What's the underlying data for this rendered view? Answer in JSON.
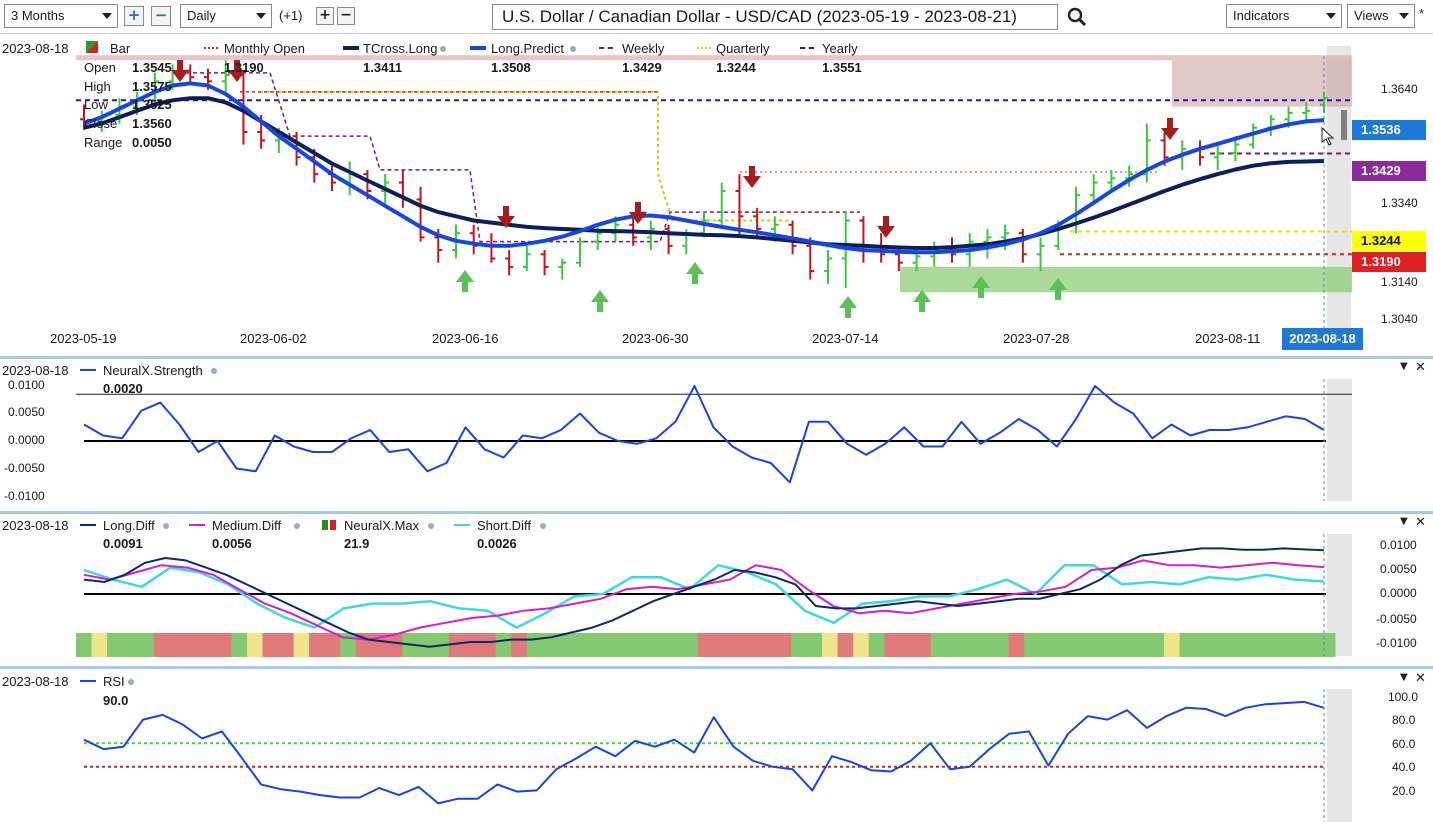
{
  "toolbar": {
    "range": "3 Months",
    "period": "Daily",
    "offset": "(+1)",
    "title": "U.S. Dollar / Canadian Dollar - USD/CAD (2023-05-19 - 2023-08-21)",
    "indicators": "Indicators",
    "views": "Views",
    "asterisk": "*"
  },
  "main": {
    "date": "2023-08-18",
    "legend": [
      {
        "label": "Bar",
        "value": "",
        "color": "#d62020"
      },
      {
        "label": "Monthly Open",
        "value": "1.3190",
        "color": "#d62020"
      },
      {
        "label": "TCross.Long",
        "value": "1.3411",
        "color": "#0b1f5a"
      },
      {
        "label": "Long.Predict",
        "value": "1.3508",
        "color": "#1646e0"
      },
      {
        "label": "Weekly",
        "value": "1.3429",
        "color": "#7a1f6a"
      },
      {
        "label": "Quarterly",
        "value": "1.3244",
        "color": "#e0e000"
      },
      {
        "label": "Yearly",
        "value": "1.3551",
        "color": "#1a1ab8"
      }
    ],
    "ohlc": {
      "open_label": "Open",
      "open": "1.3545",
      "high_label": "High",
      "high": "1.3575",
      "low_label": "Low",
      "low": "1.3525",
      "close_label": "Close",
      "close": "1.3560",
      "range_label": "Range",
      "range": "0.0050"
    },
    "y_ticks": [
      "1.3640",
      "1.3540",
      "1.3440",
      "1.3340",
      "1.3240",
      "1.3140",
      "1.3040"
    ],
    "price_tags": [
      {
        "value": "1.3536",
        "bg": "#1e78d6",
        "fg": "#ffffff"
      },
      {
        "value": "1.3429",
        "bg": "#8b2a9a",
        "fg": "#ffffff"
      },
      {
        "value": "1.3244",
        "bg": "#ffff00",
        "fg": "#111111"
      },
      {
        "value": "1.3190",
        "bg": "#e02020",
        "fg": "#ffffff"
      }
    ],
    "x_dates": [
      "2023-05-19",
      "2023-06-02",
      "2023-06-16",
      "2023-06-30",
      "2023-07-14",
      "2023-07-28",
      "2023-08-11"
    ],
    "x_date_current": "2023-08-18"
  },
  "neural": {
    "date": "2023-08-18",
    "label": "NeuralX.Strength",
    "value": "0.0020",
    "y_ticks": [
      "0.0100",
      "0.0050",
      "0.0000",
      "-0.0050",
      "-0.0100"
    ]
  },
  "diff": {
    "date": "2023-08-18",
    "legend": [
      {
        "label": "Long.Diff",
        "value": "0.0091",
        "color": "#0b2a6a"
      },
      {
        "label": "Medium.Diff",
        "value": "0.0056",
        "color": "#d020d0"
      },
      {
        "label": "NeuralX.Max",
        "value": "21.9",
        "color": "#2a8a2a"
      },
      {
        "label": "Short.Diff",
        "value": "0.0026",
        "color": "#40d8e0"
      }
    ],
    "y_ticks": [
      "0.0100",
      "0.0050",
      "0.0000",
      "-0.0050",
      "-0.0100"
    ]
  },
  "rsi": {
    "date": "2023-08-18",
    "label": "RSI",
    "value": "90.0",
    "y_ticks": [
      "100.0",
      "80.0",
      "60.0",
      "40.0",
      "20.0"
    ]
  },
  "chart_data": [
    {
      "type": "bar",
      "title": "U.S. Dollar / Canadian Dollar - USD/CAD (2023-05-19 - 2023-08-21)",
      "x_dates": [
        "2023-05-19",
        "2023-06-02",
        "2023-06-16",
        "2023-06-30",
        "2023-07-14",
        "2023-07-28",
        "2023-08-11",
        "2023-08-18"
      ],
      "ylim": [
        1.302,
        1.366
      ],
      "levels": {
        "monthly_open": 1.319,
        "weekly": 1.3429,
        "quarterly": 1.3244,
        "yearly": 1.3551
      },
      "last_bar": {
        "open": 1.3545,
        "high": 1.3575,
        "low": 1.3525,
        "close": 1.356
      },
      "ohlc": [
        [
          1.351,
          1.3545,
          1.3485,
          1.3505
        ],
        [
          1.3505,
          1.353,
          1.348,
          1.352
        ],
        [
          1.352,
          1.356,
          1.35,
          1.354
        ],
        [
          1.354,
          1.3575,
          1.352,
          1.3555
        ],
        [
          1.3555,
          1.362,
          1.354,
          1.36
        ],
        [
          1.36,
          1.364,
          1.358,
          1.3625
        ],
        [
          1.3625,
          1.364,
          1.359,
          1.361
        ],
        [
          1.361,
          1.363,
          1.358,
          1.36
        ],
        [
          1.36,
          1.365,
          1.357,
          1.3615
        ],
        [
          1.3615,
          1.3625,
          1.345,
          1.348
        ],
        [
          1.348,
          1.352,
          1.344,
          1.346
        ],
        [
          1.346,
          1.349,
          1.343,
          1.347
        ],
        [
          1.347,
          1.348,
          1.34,
          1.342
        ],
        [
          1.342,
          1.344,
          1.336,
          1.338
        ],
        [
          1.338,
          1.34,
          1.334,
          1.336
        ],
        [
          1.336,
          1.341,
          1.333,
          1.338
        ],
        [
          1.338,
          1.339,
          1.332,
          1.334
        ],
        [
          1.334,
          1.338,
          1.331,
          1.336
        ],
        [
          1.336,
          1.339,
          1.33,
          1.332
        ],
        [
          1.332,
          1.335,
          1.322,
          1.323
        ],
        [
          1.323,
          1.325,
          1.317,
          1.32
        ],
        [
          1.32,
          1.326,
          1.318,
          1.324
        ],
        [
          1.324,
          1.326,
          1.319,
          1.321
        ],
        [
          1.321,
          1.324,
          1.317,
          1.318
        ],
        [
          1.318,
          1.32,
          1.314,
          1.316
        ],
        [
          1.316,
          1.321,
          1.315,
          1.319
        ],
        [
          1.319,
          1.32,
          1.314,
          1.316
        ],
        [
          1.316,
          1.318,
          1.313,
          1.317
        ],
        [
          1.317,
          1.323,
          1.316,
          1.322
        ],
        [
          1.322,
          1.326,
          1.32,
          1.324
        ],
        [
          1.324,
          1.328,
          1.322,
          1.326
        ],
        [
          1.326,
          1.329,
          1.321,
          1.323
        ],
        [
          1.323,
          1.327,
          1.32,
          1.325
        ],
        [
          1.325,
          1.326,
          1.319,
          1.321
        ],
        [
          1.321,
          1.325,
          1.319,
          1.324
        ],
        [
          1.324,
          1.329,
          1.323,
          1.327
        ],
        [
          1.327,
          1.336,
          1.326,
          1.334
        ],
        [
          1.334,
          1.338,
          1.323,
          1.328
        ],
        [
          1.328,
          1.33,
          1.323,
          1.325
        ],
        [
          1.325,
          1.328,
          1.322,
          1.326
        ],
        [
          1.326,
          1.327,
          1.319,
          1.321
        ],
        [
          1.321,
          1.323,
          1.313,
          1.315
        ],
        [
          1.315,
          1.32,
          1.312,
          1.318
        ],
        [
          1.318,
          1.329,
          1.311,
          1.327
        ],
        [
          1.327,
          1.328,
          1.317,
          1.32
        ],
        [
          1.32,
          1.324,
          1.317,
          1.319
        ],
        [
          1.319,
          1.321,
          1.315,
          1.317
        ],
        [
          1.317,
          1.32,
          1.315,
          1.3185
        ],
        [
          1.3185,
          1.322,
          1.316,
          1.32
        ],
        [
          1.32,
          1.323,
          1.317,
          1.319
        ],
        [
          1.319,
          1.324,
          1.316,
          1.322
        ],
        [
          1.322,
          1.325,
          1.318,
          1.323
        ],
        [
          1.323,
          1.326,
          1.32,
          1.324
        ],
        [
          1.324,
          1.325,
          1.317,
          1.319
        ],
        [
          1.319,
          1.323,
          1.315,
          1.321
        ],
        [
          1.321,
          1.327,
          1.32,
          1.326
        ],
        [
          1.326,
          1.335,
          1.324,
          1.333
        ],
        [
          1.333,
          1.338,
          1.331,
          1.336
        ],
        [
          1.336,
          1.339,
          1.334,
          1.337
        ],
        [
          1.337,
          1.34,
          1.335,
          1.338
        ],
        [
          1.338,
          1.35,
          1.336,
          1.346
        ],
        [
          1.346,
          1.348,
          1.34,
          1.342
        ],
        [
          1.342,
          1.346,
          1.339,
          1.344
        ],
        [
          1.344,
          1.346,
          1.34,
          1.342
        ],
        [
          1.342,
          1.345,
          1.339,
          1.343
        ],
        [
          1.343,
          1.347,
          1.341,
          1.345
        ],
        [
          1.345,
          1.35,
          1.344,
          1.349
        ],
        [
          1.349,
          1.352,
          1.347,
          1.351
        ],
        [
          1.351,
          1.354,
          1.349,
          1.3525
        ],
        [
          1.3525,
          1.355,
          1.35,
          1.353
        ],
        [
          1.3545,
          1.3575,
          1.3525,
          1.356
        ]
      ],
      "series": [
        {
          "name": "TCross.Long",
          "values": [
            1.349,
            1.35,
            1.3515,
            1.353,
            1.3545,
            1.3555,
            1.356,
            1.356,
            1.355,
            1.353,
            1.3505,
            1.348,
            1.3455,
            1.343,
            1.3405,
            1.3385,
            1.3365,
            1.3345,
            1.3325,
            1.3305,
            1.329,
            1.328,
            1.327,
            1.3265,
            1.326,
            1.3255,
            1.3252,
            1.325,
            1.3248,
            1.3246,
            1.3245,
            1.3244,
            1.3242,
            1.324,
            1.3238,
            1.3236,
            1.3235,
            1.3233,
            1.323,
            1.3226,
            1.3222,
            1.3218,
            1.3214,
            1.3212,
            1.321,
            1.3208,
            1.3206,
            1.3205,
            1.3205,
            1.3207,
            1.321,
            1.3214,
            1.322,
            1.3228,
            1.3238,
            1.325,
            1.3263,
            1.3277,
            1.3292,
            1.3308,
            1.3324,
            1.334,
            1.3355,
            1.3368,
            1.338,
            1.3391,
            1.34,
            1.3406,
            1.3409,
            1.341,
            1.3411
          ]
        },
        {
          "name": "Long.Predict",
          "values": [
            1.35,
            1.3515,
            1.3535,
            1.3555,
            1.3575,
            1.359,
            1.3595,
            1.359,
            1.357,
            1.354,
            1.3505,
            1.347,
            1.344,
            1.341,
            1.338,
            1.3355,
            1.333,
            1.3305,
            1.328,
            1.3255,
            1.3235,
            1.3222,
            1.3215,
            1.321,
            1.321,
            1.3215,
            1.3222,
            1.3232,
            1.3245,
            1.326,
            1.3272,
            1.328,
            1.3282,
            1.3278,
            1.327,
            1.3262,
            1.3255,
            1.3248,
            1.3242,
            1.3235,
            1.3228,
            1.322,
            1.3212,
            1.3205,
            1.32,
            1.3198,
            1.3196,
            1.3195,
            1.3195,
            1.3197,
            1.32,
            1.3206,
            1.3214,
            1.3225,
            1.324,
            1.326,
            1.3285,
            1.3312,
            1.334,
            1.3366,
            1.339,
            1.341,
            1.3426,
            1.344,
            1.3452,
            1.3464,
            1.3476,
            1.3488,
            1.3498,
            1.3505,
            1.3508
          ]
        }
      ]
    },
    {
      "type": "line",
      "title": "NeuralX.Strength",
      "ylim": [
        -0.01,
        0.01
      ],
      "series": [
        {
          "name": "NeuralX.Strength",
          "values": [
            0.003,
            0.001,
            0.0005,
            0.0055,
            0.007,
            0.003,
            -0.002,
            0.0,
            -0.005,
            -0.0055,
            0.001,
            -0.001,
            -0.002,
            -0.002,
            0.0005,
            0.002,
            -0.002,
            -0.0015,
            -0.0055,
            -0.004,
            0.0025,
            -0.0015,
            -0.003,
            0.001,
            0.0005,
            0.002,
            0.005,
            0.0015,
            0.0,
            -0.0005,
            0.0005,
            0.0035,
            0.01,
            0.0025,
            -0.001,
            -0.003,
            -0.004,
            -0.0075,
            0.0035,
            0.0035,
            -0.0005,
            -0.0025,
            -0.0005,
            0.0025,
            -0.001,
            -0.001,
            0.0035,
            -0.0005,
            0.0015,
            0.004,
            0.002,
            -0.001,
            0.004,
            0.01,
            0.007,
            0.005,
            0.0005,
            0.003,
            0.001,
            0.002,
            0.002,
            0.0025,
            0.0035,
            0.0045,
            0.004,
            0.002
          ]
        }
      ]
    },
    {
      "type": "line",
      "title": "Long.Diff / Medium.Diff / NeuralX.Max / Short.Diff",
      "ylim": [
        -0.01,
        0.01
      ],
      "series": [
        {
          "name": "Long.Diff",
          "values": [
            0.003,
            0.0025,
            0.004,
            0.0065,
            0.0075,
            0.007,
            0.0055,
            0.004,
            0.002,
            0.0,
            -0.002,
            -0.004,
            -0.006,
            -0.008,
            -0.0095,
            -0.01,
            -0.0105,
            -0.011,
            -0.0105,
            -0.01,
            -0.01,
            -0.0095,
            -0.0095,
            -0.009,
            -0.008,
            -0.007,
            -0.0055,
            -0.0035,
            -0.0015,
            0.0,
            0.0015,
            0.003,
            0.005,
            0.0045,
            0.0035,
            0.002,
            -0.0025,
            -0.003,
            -0.003,
            -0.0025,
            -0.002,
            -0.0015,
            -0.002,
            -0.0025,
            -0.002,
            -0.0015,
            -0.001,
            -0.001,
            0.0,
            0.001,
            0.003,
            0.006,
            0.008,
            0.0085,
            0.009,
            0.0095,
            0.0095,
            0.0092,
            0.0092,
            0.0095,
            0.0093,
            0.0091
          ]
        },
        {
          "name": "Medium.Diff",
          "values": [
            0.004,
            0.003,
            0.0045,
            0.006,
            0.0055,
            0.004,
            0.001,
            -0.002,
            -0.004,
            -0.0065,
            -0.009,
            -0.0095,
            -0.0085,
            -0.007,
            -0.006,
            -0.005,
            -0.0045,
            -0.0035,
            -0.003,
            -0.002,
            -0.001,
            0.001,
            0.0015,
            0.001,
            0.002,
            0.003,
            0.006,
            0.005,
            0.001,
            -0.0025,
            -0.004,
            -0.0035,
            -0.004,
            -0.003,
            -0.002,
            -0.001,
            0.0,
            0.0005,
            0.0015,
            0.005,
            0.0055,
            0.007,
            0.006,
            0.006,
            0.0055,
            0.006,
            0.0065,
            0.006,
            0.0056
          ]
        },
        {
          "name": "Short.Diff",
          "values": [
            0.005,
            0.003,
            0.0015,
            0.0055,
            0.0045,
            0.002,
            -0.002,
            -0.005,
            -0.007,
            -0.003,
            -0.002,
            -0.002,
            -0.0015,
            -0.003,
            -0.0035,
            -0.007,
            -0.004,
            -0.0005,
            0.0,
            0.0035,
            0.0035,
            0.001,
            0.006,
            0.0045,
            0.002,
            -0.0035,
            -0.006,
            -0.002,
            -0.0015,
            -0.0005,
            -0.0005,
            0.001,
            0.003,
            0.0,
            0.006,
            0.006,
            0.002,
            0.0025,
            0.002,
            0.0035,
            0.003,
            0.004,
            0.003,
            0.0026
          ]
        }
      ]
    },
    {
      "type": "line",
      "title": "RSI",
      "ylim": [
        0,
        100
      ],
      "levels": {
        "overbought": 60,
        "oversold": 40
      },
      "series": [
        {
          "name": "RSI",
          "values": [
            63,
            55,
            57,
            80,
            84,
            76,
            64,
            70,
            48,
            25,
            21,
            19,
            16,
            14,
            14,
            22,
            16,
            23,
            9,
            13,
            13,
            25,
            19,
            20,
            38,
            47,
            57,
            49,
            62,
            57,
            63,
            52,
            82,
            57,
            45,
            40,
            38,
            20,
            49,
            44,
            37,
            36,
            45,
            60,
            38,
            40,
            55,
            68,
            70,
            41,
            68,
            83,
            80,
            88,
            73,
            83,
            90,
            89,
            83,
            90,
            93,
            94,
            95,
            90
          ]
        }
      ]
    }
  ]
}
